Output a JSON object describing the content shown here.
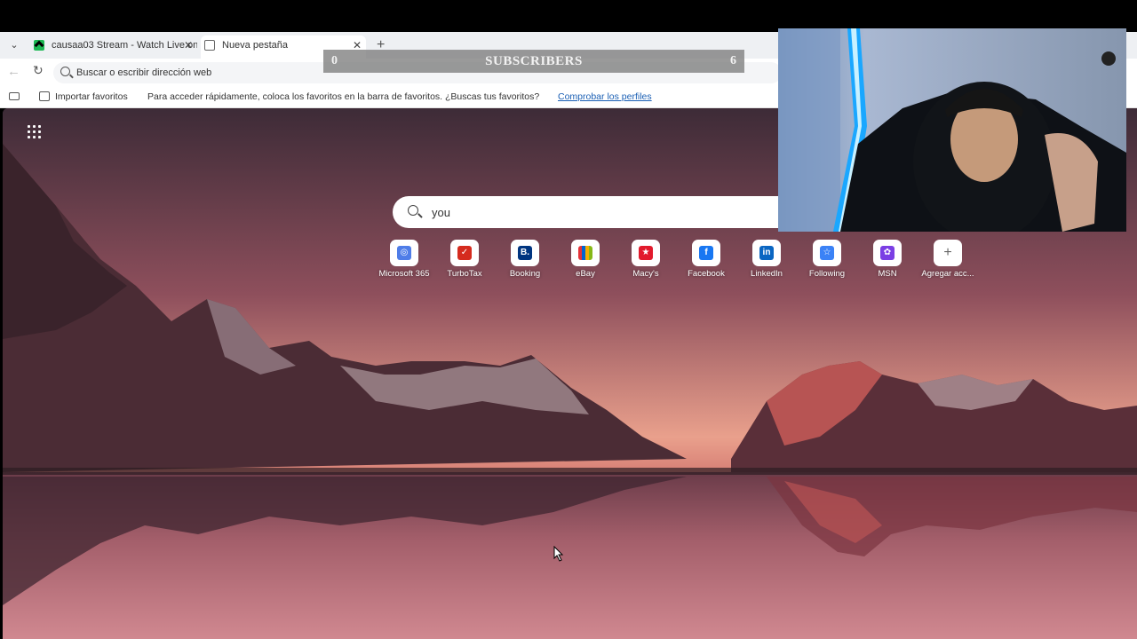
{
  "browser": {
    "tabs": [
      {
        "title": "causaa03 Stream - Watch Live on",
        "active": false
      },
      {
        "title": "Nueva pestaña",
        "active": true
      }
    ],
    "address_placeholder": "Buscar o escribir dirección web",
    "favorites_bar": {
      "import_label": "Importar favoritos",
      "hint": "Para acceder rápidamente, coloca los favoritos en la barra de favoritos. ¿Buscas tus favoritos?",
      "link": "Comprobar los perfiles"
    }
  },
  "ntp": {
    "search_value": "you",
    "shortcuts": [
      {
        "label": "Microsoft 365",
        "icon": "microsoft-365-icon",
        "color": "#4f7de8",
        "glyph": "◎"
      },
      {
        "label": "TurboTax",
        "icon": "turbotax-icon",
        "color": "#d52b1e",
        "glyph": "✓"
      },
      {
        "label": "Booking",
        "icon": "booking-icon",
        "color": "#003580",
        "glyph": "B."
      },
      {
        "label": "eBay",
        "icon": "ebay-icon",
        "color": "#1a1a1a",
        "glyph": ""
      },
      {
        "label": "Macy's",
        "icon": "macys-icon",
        "color": "#e21a2c",
        "glyph": "★"
      },
      {
        "label": "Facebook",
        "icon": "facebook-icon",
        "color": "#1877f2",
        "glyph": "f"
      },
      {
        "label": "LinkedIn",
        "icon": "linkedin-icon",
        "color": "#0a66c2",
        "glyph": "in"
      },
      {
        "label": "Following",
        "icon": "following-icon",
        "color": "#3b82f6",
        "glyph": "☆"
      },
      {
        "label": "MSN",
        "icon": "msn-icon",
        "color": "#7b3fe4",
        "glyph": "✿"
      },
      {
        "label": "Agregar acc...",
        "icon": "plus-icon",
        "color": "#666666",
        "glyph": "+"
      }
    ]
  },
  "overlay": {
    "left_count": "0",
    "title": "SUBSCRIBERS",
    "right_count": "6"
  }
}
